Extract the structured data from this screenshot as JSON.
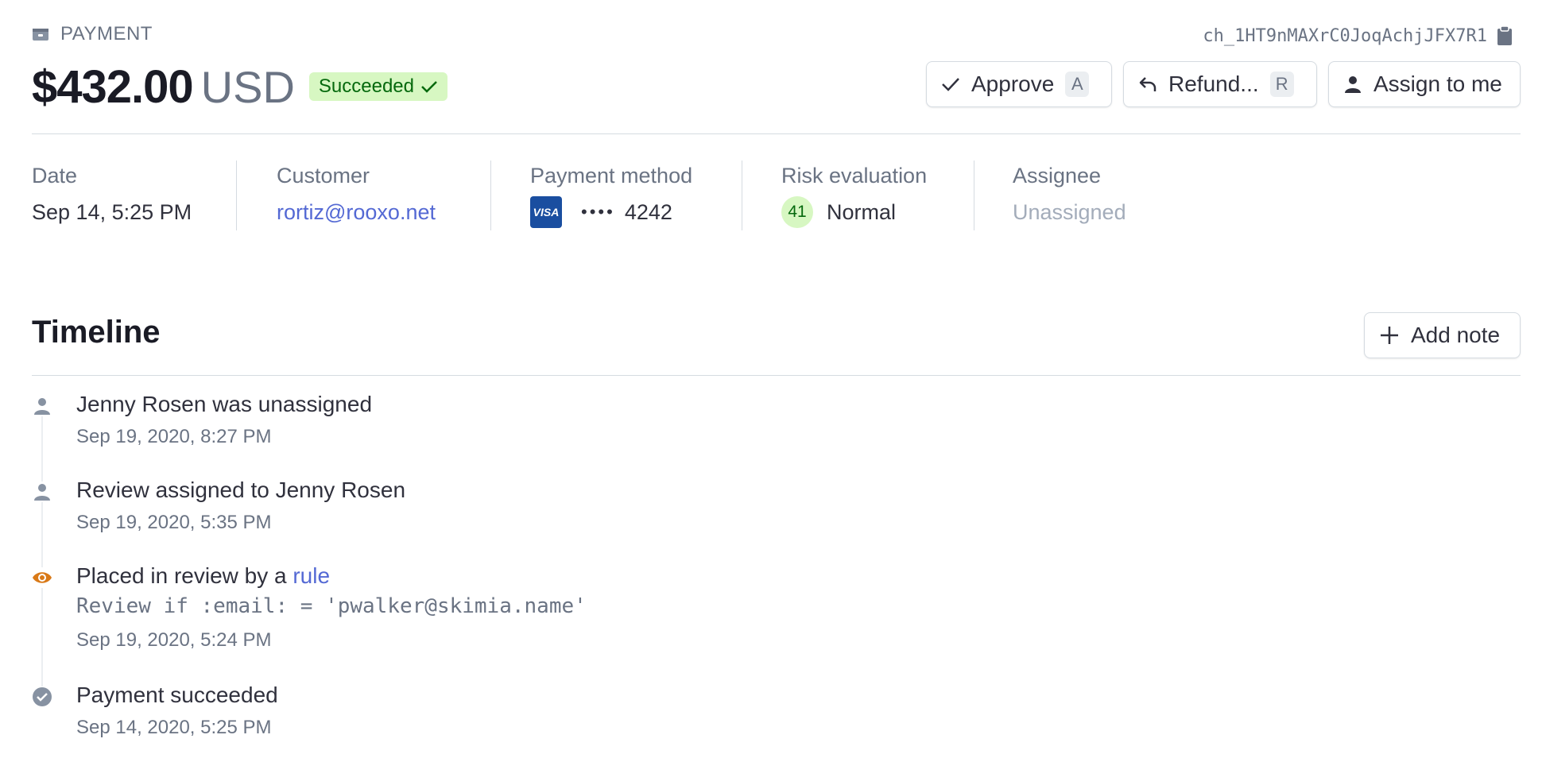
{
  "header": {
    "kicker": "PAYMENT",
    "charge_id": "ch_1HT9nMAXrC0JoqAchjJFX7R1",
    "amount": "$432.00",
    "currency": "USD",
    "status": "Succeeded"
  },
  "actions": {
    "approve": {
      "label": "Approve",
      "shortcut": "A"
    },
    "refund": {
      "label": "Refund...",
      "shortcut": "R"
    },
    "assign": {
      "label": "Assign to me"
    }
  },
  "summary": {
    "date": {
      "label": "Date",
      "value": "Sep 14, 5:25 PM"
    },
    "customer": {
      "label": "Customer",
      "value": "rortiz@rooxo.net"
    },
    "payment_method": {
      "label": "Payment method",
      "brand": "VISA",
      "dots": "••••",
      "last4": "4242"
    },
    "risk": {
      "label": "Risk evaluation",
      "score": "41",
      "level": "Normal"
    },
    "assignee": {
      "label": "Assignee",
      "value": "Unassigned"
    }
  },
  "timeline": {
    "title": "Timeline",
    "add_note": "Add note",
    "events": [
      {
        "icon": "person-icon",
        "title": "Jenny Rosen was unassigned",
        "time": "Sep 19, 2020, 8:27 PM"
      },
      {
        "icon": "person-icon",
        "title": "Review assigned to Jenny Rosen",
        "time": "Sep 19, 2020, 5:35 PM"
      },
      {
        "icon": "eye-icon",
        "title_prefix": "Placed in review by a",
        "title_link": "rule",
        "code": "Review if :email: = 'pwalker@skimia.name'",
        "time": "Sep 19, 2020, 5:24 PM"
      },
      {
        "icon": "check-circle-icon",
        "title": "Payment succeeded",
        "time": "Sep 14, 2020, 5:25 PM"
      }
    ]
  },
  "colors": {
    "accent": "#5469d4",
    "success_bg": "#d7f7c2",
    "success_text": "#05690d",
    "review_orange": "#d97917",
    "muted": "#6a7383"
  }
}
